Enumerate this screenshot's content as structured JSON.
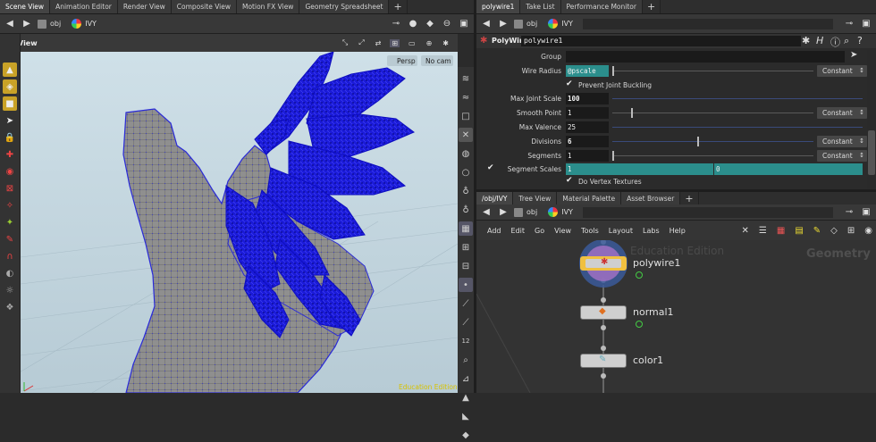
{
  "left_pane": {
    "tabs": [
      "Scene View",
      "Animation Editor",
      "Render View",
      "Composite View",
      "Motion FX View",
      "Geometry Spreadsheet"
    ],
    "path": [
      "obj",
      "IVY"
    ],
    "view_label": "View",
    "persp": "Persp",
    "cam": "No cam",
    "watermark": "Education Edition"
  },
  "params_pane": {
    "tabs": [
      "polywire1",
      "Take List",
      "Performance Monitor"
    ],
    "path": [
      "obj",
      "IVY"
    ],
    "node_type": "PolyWire",
    "node_name": "polywire1",
    "rows": [
      {
        "label": "Group",
        "value": ""
      },
      {
        "label": "Wire Radius",
        "value": "@pscale",
        "mode": "Constant"
      },
      {
        "label": "Prevent Joint Buckling",
        "checked": true
      },
      {
        "label": "Max Joint Scale",
        "value": "100"
      },
      {
        "label": "Smooth Point",
        "value": "1",
        "mode": "Constant"
      },
      {
        "label": "Max Valence",
        "value": "25"
      },
      {
        "label": "Divisions",
        "value": "6",
        "mode": "Constant"
      },
      {
        "label": "Segments",
        "value": "1",
        "mode": "Constant"
      },
      {
        "label": "Segment Scales",
        "value": "1",
        "value2": "0"
      },
      {
        "label": "Do Vertex Textures",
        "checked": true
      }
    ]
  },
  "network_pane": {
    "tabs": [
      "/obj/IVY",
      "Tree View",
      "Material Palette",
      "Asset Browser"
    ],
    "path": [
      "obj",
      "IVY"
    ],
    "menu": [
      "Add",
      "Edit",
      "Go",
      "View",
      "Tools",
      "Layout",
      "Labs",
      "Help"
    ],
    "watermark": "Education Edition",
    "context": "Geometry",
    "nodes": [
      "polywire1",
      "normal1",
      "color1"
    ]
  },
  "colors": {
    "teal": "#2b8e8c",
    "points": "#1a1ad8",
    "mesh": "#8c8c8c",
    "selected_node": "#f0c040"
  }
}
